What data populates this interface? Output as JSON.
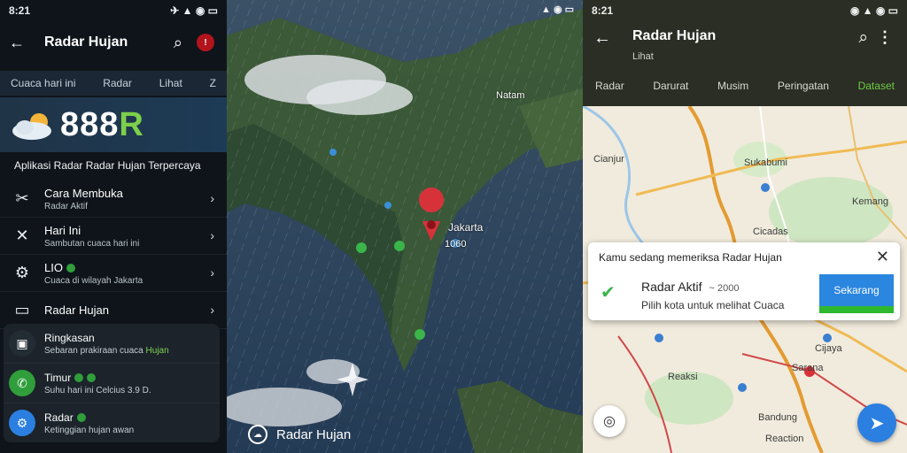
{
  "left": {
    "status_time": "8:21",
    "status_icons": "✈ ▲ ◉ ▭",
    "app_title": "Radar Hujan",
    "tabs": [
      "Cuaca hari ini",
      "Radar",
      "Lihat",
      "Z"
    ],
    "hero_number": "888",
    "hero_letter": "R",
    "subtitle": "Aplikasi Radar Radar Hujan Terpercaya",
    "list": [
      {
        "title": "Cara Membuka",
        "subtitle": "Radar Aktif"
      },
      {
        "title": "Hari Ini",
        "subtitle": "Sambutan cuaca hari ini"
      },
      {
        "title": "LIO",
        "subtitle": "Cuaca di wilayah Jakarta"
      },
      {
        "title": "Radar Hujan",
        "subtitle": ""
      }
    ],
    "card": [
      {
        "title": "Ringkasan",
        "subtitle": "Sebaran prakiraan cuaca",
        "highlight": "Hujan"
      },
      {
        "title": "Timur",
        "subtitle": "Suhu hari ini Celcius 3.9 D."
      },
      {
        "title": "Radar",
        "subtitle": "Ketinggian hujan awan"
      }
    ]
  },
  "middle": {
    "status": "▲ ◉ ▭",
    "labels": {
      "north": "Natam",
      "west": "",
      "pin": "Jakarta",
      "pin_sub": "1060"
    },
    "bottom_label": "Radar Hujan"
  },
  "right": {
    "status_time": "8:21",
    "status_icons": "◉ ▲ ◉ ▭",
    "app_title": "Radar Hujan",
    "app_sub": "Lihat",
    "tabs": [
      "Radar",
      "Darurat",
      "Musim",
      "Peringatan",
      "Dataset"
    ],
    "active_tab_index": 4,
    "map_labels": {
      "a": "Sukabumi",
      "b": "Cianjur",
      "c": "Kemang",
      "d": "Cicadas",
      "e": "Reaksi",
      "f": "Sarana",
      "g": "Bandung",
      "h": "Reaction",
      "i": "Cijaya"
    },
    "dialog": {
      "title": "Kamu sedang memeriksa Radar Hujan",
      "item_title": "Radar Aktif",
      "item_meta": "~ 2000",
      "item_sub": "Pilih kota untuk melihat Cuaca",
      "button": "Sekarang"
    }
  },
  "colors": {
    "accent_blue": "#2b7fe0",
    "accent_green": "#6ccc46",
    "pin_red": "#d7323a"
  }
}
